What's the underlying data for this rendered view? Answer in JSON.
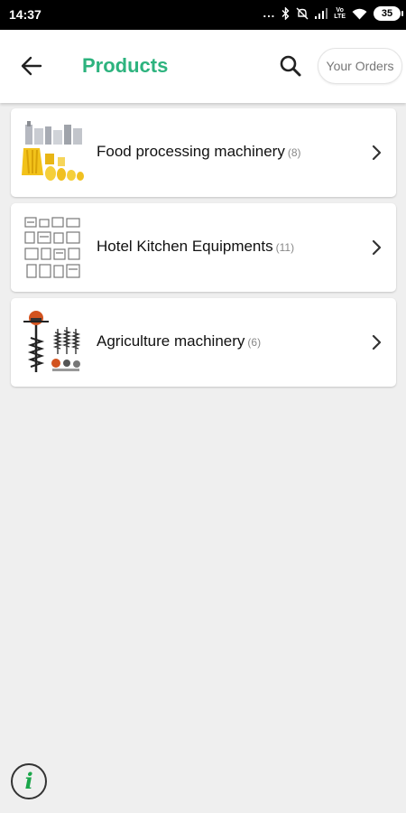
{
  "status_bar": {
    "time": "14:37",
    "battery": "35",
    "volte_line1": "Vo",
    "volte_line2": "LTE"
  },
  "app_bar": {
    "title": "Products",
    "orders_button": "Your Orders",
    "back_icon": "back-arrow-icon",
    "search_icon": "search-icon"
  },
  "categories": [
    {
      "name": "Food processing machinery",
      "count": "(8)",
      "image": "food-machinery-thumbnail"
    },
    {
      "name": "Hotel Kitchen Equipments",
      "count": "(11)",
      "image": "kitchen-equipment-thumbnail"
    },
    {
      "name": "Agriculture machinery",
      "count": "(6)",
      "image": "agriculture-machinery-thumbnail"
    }
  ],
  "info_button": {
    "label": "i"
  },
  "colors": {
    "accent": "#2db37e",
    "info_icon": "#1aa64a",
    "background": "#efefef"
  }
}
